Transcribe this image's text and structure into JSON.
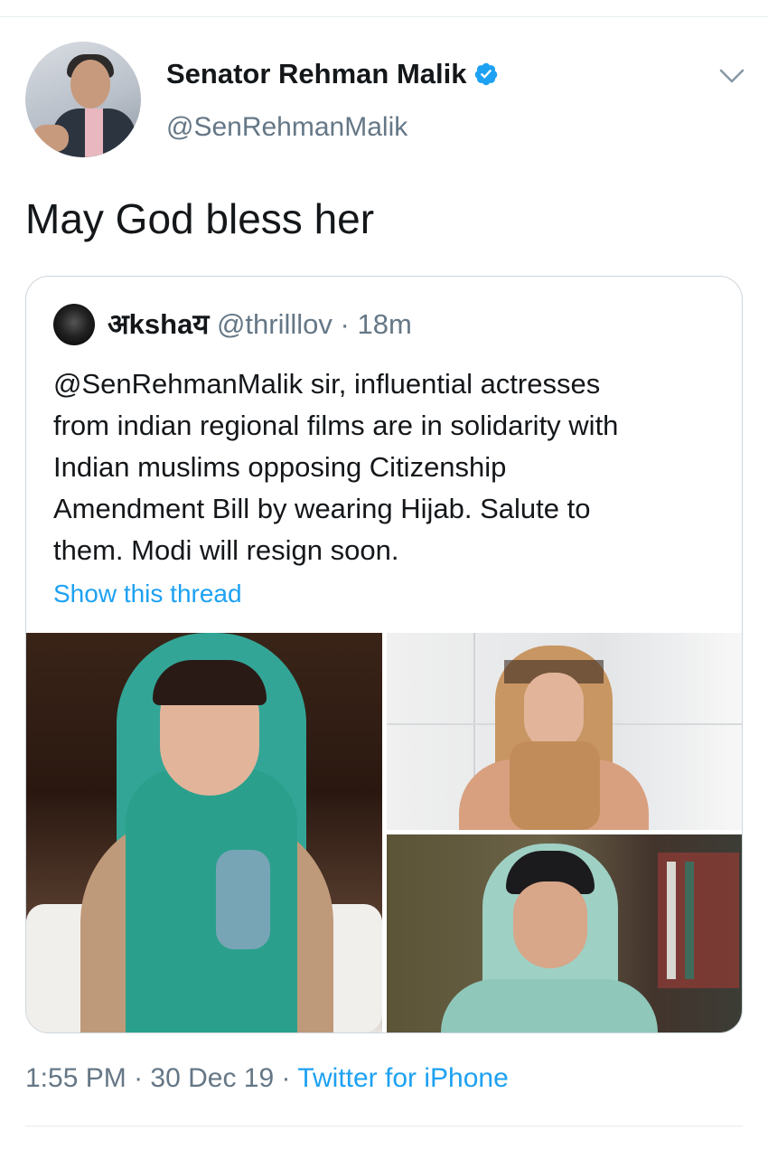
{
  "tweet": {
    "display_name": "Senator Rehman Malik",
    "handle": "@SenRehmanMalik",
    "text": "May God bless her",
    "time": "1:55 PM",
    "date": "30 Dec 19",
    "source": "Twitter for iPhone",
    "separator": "·"
  },
  "quoted_tweet": {
    "name": "अkshaय",
    "handle": "@thrilllov",
    "separator": "·",
    "age": "18m",
    "text_lines": [
      "@SenRehmanMalik sir, influential actresses",
      "from indian regional films are in solidarity with",
      "Indian muslims opposing Citizenship",
      "Amendment Bill by wearing Hijab. Salute to",
      "them. Modi will resign soon."
    ],
    "show_thread": "Show this thread"
  },
  "colors": {
    "accent": "#1da1f2",
    "text_primary": "#14171a",
    "text_secondary": "#657786",
    "border": "#ccd6dd",
    "verified": "#1da1f2"
  },
  "icons": {
    "verified": "verified-badge-icon",
    "menu": "chevron-down-icon"
  }
}
